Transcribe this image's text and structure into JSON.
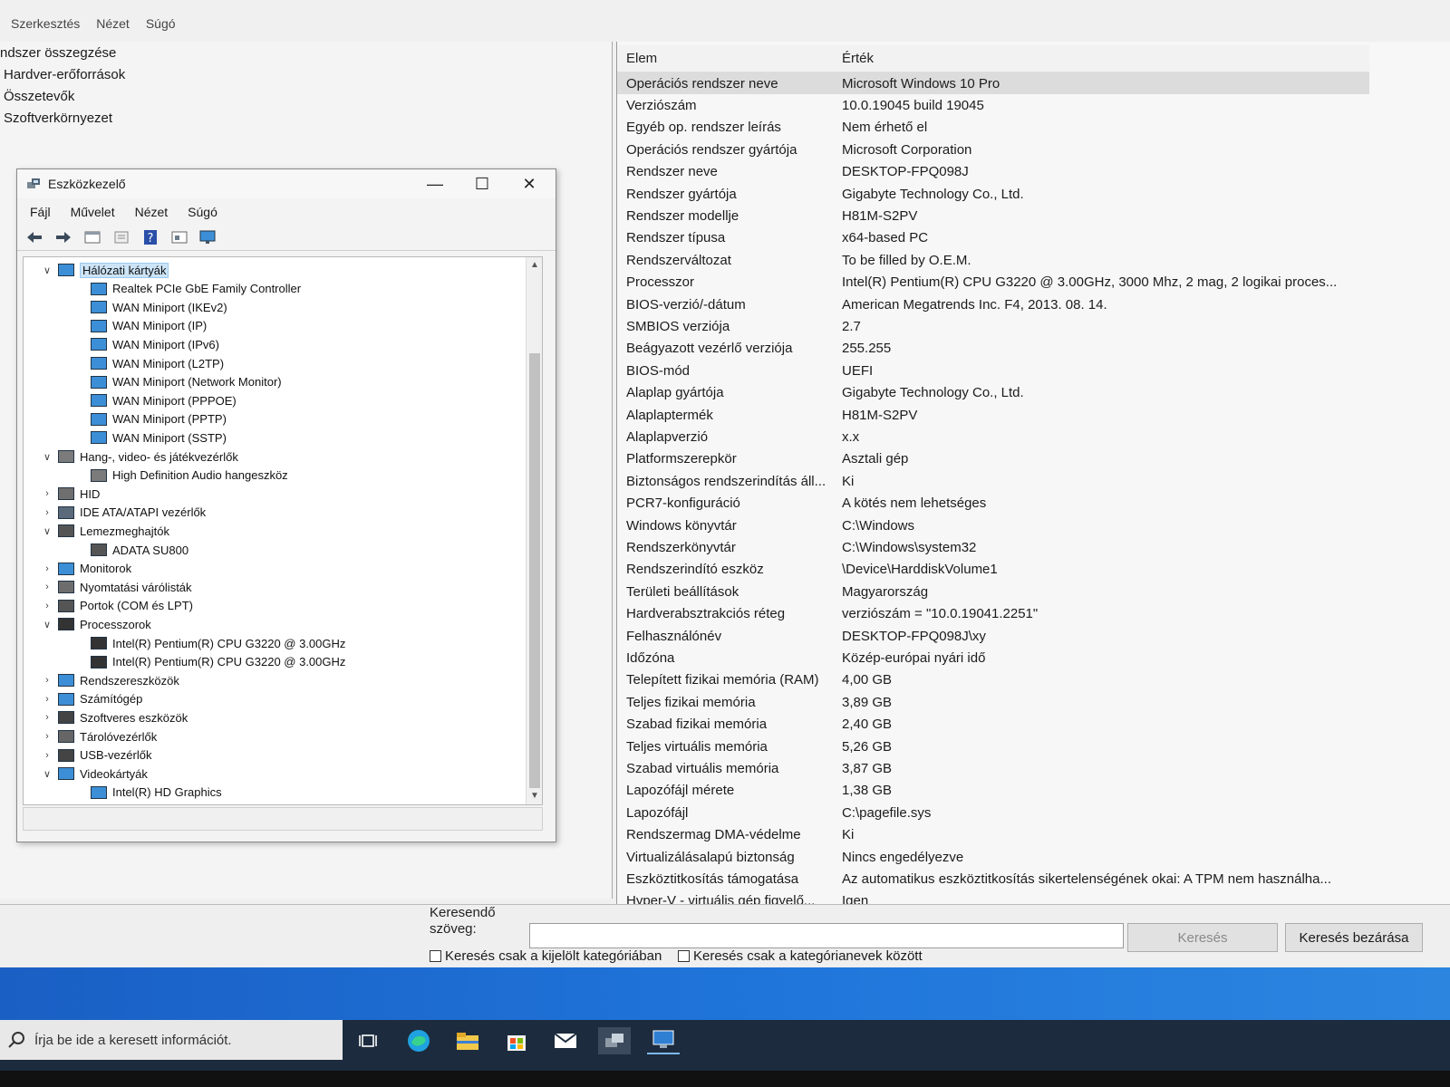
{
  "msinfo": {
    "menu": [
      "Szerkesztés",
      "Nézet",
      "Súgó"
    ],
    "tree": [
      "ndszer összegzése",
      "Hardver-erőforrások",
      "Összetevők",
      "Szoftverkörnyezet"
    ],
    "columns": {
      "item": "Elem",
      "value": "Érték"
    },
    "rows": [
      {
        "k": "Operációs rendszer neve",
        "v": "Microsoft Windows 10 Pro"
      },
      {
        "k": "Verziószám",
        "v": "10.0.19045 build 19045"
      },
      {
        "k": "Egyéb op. rendszer leírás",
        "v": "Nem érhető el"
      },
      {
        "k": "Operációs rendszer gyártója",
        "v": "Microsoft Corporation"
      },
      {
        "k": "Rendszer neve",
        "v": "DESKTOP-FPQ098J"
      },
      {
        "k": "Rendszer gyártója",
        "v": "Gigabyte Technology Co., Ltd."
      },
      {
        "k": "Rendszer modellje",
        "v": "H81M-S2PV"
      },
      {
        "k": "Rendszer típusa",
        "v": "x64-based PC"
      },
      {
        "k": "Rendszerváltozat",
        "v": "To be filled by O.E.M."
      },
      {
        "k": "Processzor",
        "v": "Intel(R) Pentium(R) CPU G3220 @ 3.00GHz, 3000 Mhz, 2 mag, 2 logikai proces..."
      },
      {
        "k": "BIOS-verzió/-dátum",
        "v": "American Megatrends Inc. F4, 2013. 08. 14."
      },
      {
        "k": "SMBIOS verziója",
        "v": "2.7"
      },
      {
        "k": "Beágyazott vezérlő verziója",
        "v": "255.255"
      },
      {
        "k": "BIOS-mód",
        "v": "UEFI"
      },
      {
        "k": "Alaplap gyártója",
        "v": "Gigabyte Technology Co., Ltd."
      },
      {
        "k": "Alaplaptermék",
        "v": "H81M-S2PV"
      },
      {
        "k": "Alaplapverzió",
        "v": "x.x"
      },
      {
        "k": "Platformszerepkör",
        "v": "Asztali gép"
      },
      {
        "k": "Biztonságos rendszerindítás áll...",
        "v": "Ki"
      },
      {
        "k": "PCR7-konfiguráció",
        "v": "A kötés nem lehetséges"
      },
      {
        "k": "Windows könyvtár",
        "v": "C:\\Windows"
      },
      {
        "k": "Rendszerkönyvtár",
        "v": "C:\\Windows\\system32"
      },
      {
        "k": "Rendszerindító eszköz",
        "v": "\\Device\\HarddiskVolume1"
      },
      {
        "k": "Területi beállítások",
        "v": "Magyarország"
      },
      {
        "k": "Hardverabsztrakciós réteg",
        "v": "verziószám = \"10.0.19041.2251\""
      },
      {
        "k": "Felhasználónév",
        "v": "DESKTOP-FPQ098J\\xy"
      },
      {
        "k": "Időzóna",
        "v": "Közép-európai nyári idő"
      },
      {
        "k": "Telepített fizikai memória (RAM)",
        "v": "4,00 GB"
      },
      {
        "k": "Teljes fizikai memória",
        "v": "3,89 GB"
      },
      {
        "k": "Szabad fizikai memória",
        "v": "2,40 GB"
      },
      {
        "k": "Teljes virtuális memória",
        "v": "5,26 GB"
      },
      {
        "k": "Szabad virtuális memória",
        "v": "3,87 GB"
      },
      {
        "k": "Lapozófájl mérete",
        "v": "1,38 GB"
      },
      {
        "k": "Lapozófájl",
        "v": "C:\\pagefile.sys"
      },
      {
        "k": "Rendszermag DMA-védelme",
        "v": "Ki"
      },
      {
        "k": "Virtualizálásalapú biztonság",
        "v": "Nincs engedélyezve"
      },
      {
        "k": "Eszköztitkosítás támogatása",
        "v": "Az automatikus eszköztitkosítás sikertelenségének okai: A TPM nem használha..."
      },
      {
        "k": "Hyper-V - virtuális gép figyelő...",
        "v": "Igen"
      }
    ],
    "search": {
      "label": "Keresendő szöveg:",
      "value": "",
      "search_button": "Keresés",
      "close_button": "Keresés bezárása",
      "check1": "Keresés csak a kijelölt kategóriában",
      "check2": "Keresés csak a kategórianevek között"
    }
  },
  "devmgr": {
    "title": "Eszközkezelő",
    "menu": [
      "Fájl",
      "Művelet",
      "Nézet",
      "Súgó"
    ],
    "nodes": [
      {
        "level": 0,
        "twisty": "open",
        "icon": "network-adapter-icon",
        "label": "Hálózati kártyák",
        "selected": true
      },
      {
        "level": 1,
        "twisty": "",
        "icon": "network-adapter-icon",
        "label": "Realtek PCIe GbE Family Controller"
      },
      {
        "level": 1,
        "twisty": "",
        "icon": "network-adapter-icon",
        "label": "WAN Miniport (IKEv2)"
      },
      {
        "level": 1,
        "twisty": "",
        "icon": "network-adapter-icon",
        "label": "WAN Miniport (IP)"
      },
      {
        "level": 1,
        "twisty": "",
        "icon": "network-adapter-icon",
        "label": "WAN Miniport (IPv6)"
      },
      {
        "level": 1,
        "twisty": "",
        "icon": "network-adapter-icon",
        "label": "WAN Miniport (L2TP)"
      },
      {
        "level": 1,
        "twisty": "",
        "icon": "network-adapter-icon",
        "label": "WAN Miniport (Network Monitor)"
      },
      {
        "level": 1,
        "twisty": "",
        "icon": "network-adapter-icon",
        "label": "WAN Miniport (PPPOE)"
      },
      {
        "level": 1,
        "twisty": "",
        "icon": "network-adapter-icon",
        "label": "WAN Miniport (PPTP)"
      },
      {
        "level": 1,
        "twisty": "",
        "icon": "network-adapter-icon",
        "label": "WAN Miniport (SSTP)"
      },
      {
        "level": 0,
        "twisty": "open",
        "icon": "speaker-icon",
        "label": "Hang-, video- és játékvezérlők"
      },
      {
        "level": 1,
        "twisty": "",
        "icon": "speaker-icon",
        "label": "High Definition Audio hangeszköz"
      },
      {
        "level": 0,
        "twisty": "closed",
        "icon": "hid-icon",
        "label": "HID"
      },
      {
        "level": 0,
        "twisty": "closed",
        "icon": "ide-controller-icon",
        "label": "IDE ATA/ATAPI vezérlők"
      },
      {
        "level": 0,
        "twisty": "open",
        "icon": "disk-drive-icon",
        "label": "Lemezmeghajtók"
      },
      {
        "level": 1,
        "twisty": "",
        "icon": "disk-drive-icon",
        "label": "ADATA SU800"
      },
      {
        "level": 0,
        "twisty": "closed",
        "icon": "monitor-icon",
        "label": "Monitorok"
      },
      {
        "level": 0,
        "twisty": "closed",
        "icon": "printer-icon",
        "label": "Nyomtatási várólisták"
      },
      {
        "level": 0,
        "twisty": "closed",
        "icon": "port-icon",
        "label": "Portok (COM és LPT)"
      },
      {
        "level": 0,
        "twisty": "open",
        "icon": "processor-icon",
        "label": "Processzorok"
      },
      {
        "level": 1,
        "twisty": "",
        "icon": "processor-icon",
        "label": "Intel(R) Pentium(R) CPU G3220 @ 3.00GHz"
      },
      {
        "level": 1,
        "twisty": "",
        "icon": "processor-icon",
        "label": "Intel(R) Pentium(R) CPU G3220 @ 3.00GHz"
      },
      {
        "level": 0,
        "twisty": "closed",
        "icon": "system-devices-icon",
        "label": "Rendszereszközök"
      },
      {
        "level": 0,
        "twisty": "closed",
        "icon": "computer-icon",
        "label": "Számítógép"
      },
      {
        "level": 0,
        "twisty": "closed",
        "icon": "software-device-icon",
        "label": "Szoftveres eszközök"
      },
      {
        "level": 0,
        "twisty": "closed",
        "icon": "storage-controller-icon",
        "label": "Tárolóvezérlők"
      },
      {
        "level": 0,
        "twisty": "closed",
        "icon": "usb-icon",
        "label": "USB-vezérlők"
      },
      {
        "level": 0,
        "twisty": "open",
        "icon": "display-adapter-icon",
        "label": "Videokártyák"
      },
      {
        "level": 1,
        "twisty": "",
        "icon": "display-adapter-icon",
        "label": "Intel(R) HD Graphics"
      }
    ]
  },
  "taskbar": {
    "search_placeholder": "Írja be ide a keresett információt.",
    "icons": [
      "task-view-icon",
      "edge-icon",
      "file-explorer-icon",
      "store-icon",
      "mail-icon",
      "device-manager-icon",
      "system-info-icon"
    ]
  },
  "colors": {
    "desktop": "#1f74da",
    "taskbar": "#1c2b3d",
    "selection": "#cce4f7"
  }
}
